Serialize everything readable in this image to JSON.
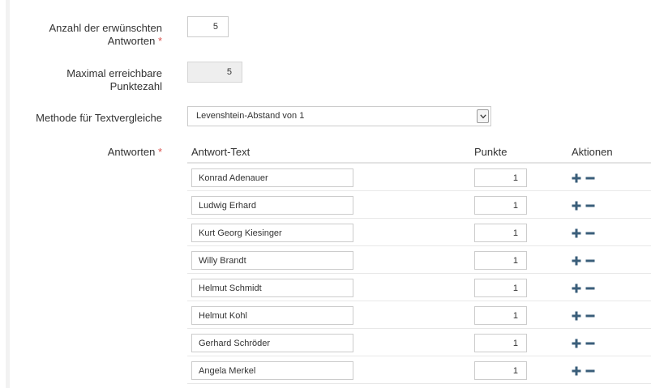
{
  "form": {
    "desired_answers": {
      "label": "Anzahl der erwünschten",
      "label_line2": "Antworten",
      "required_mark": "*",
      "value": "5"
    },
    "max_points": {
      "label": "Maximal erreichbare",
      "label_line2": "Punktezahl",
      "value": "5"
    },
    "text_compare": {
      "label": "Methode für Textvergleiche",
      "selected": "Levenshtein-Abstand von 1"
    },
    "answers": {
      "label": "Antworten",
      "required_mark": "*"
    }
  },
  "table": {
    "headers": {
      "text": "Antwort-Text",
      "points": "Punkte",
      "actions": "Aktionen"
    },
    "rows": [
      {
        "text": "Konrad Adenauer",
        "points": "1"
      },
      {
        "text": "Ludwig Erhard",
        "points": "1"
      },
      {
        "text": "Kurt Georg Kiesinger",
        "points": "1"
      },
      {
        "text": "Willy Brandt",
        "points": "1"
      },
      {
        "text": "Helmut Schmidt",
        "points": "1"
      },
      {
        "text": "Helmut Kohl",
        "points": "1"
      },
      {
        "text": "Gerhard Schröder",
        "points": "1"
      },
      {
        "text": "Angela Merkel",
        "points": "1"
      }
    ]
  },
  "icons": {
    "add": "plus-icon",
    "remove": "minus-icon",
    "dropdown": "chevron-down-icon"
  },
  "colors": {
    "required": "#d9534f",
    "action_icons": "#3a5e7a"
  }
}
